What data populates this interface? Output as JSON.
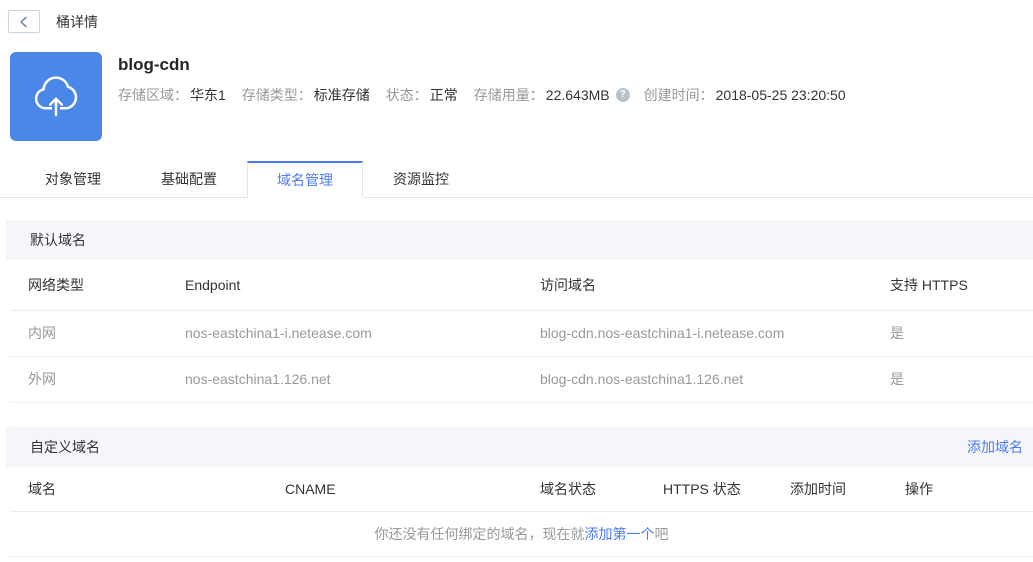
{
  "page": {
    "title": "桶详情"
  },
  "icons": {
    "help_glyph": "?"
  },
  "colors": {
    "accent_blue": "#4d7bf3",
    "bucket_icon_bg": "#4a87e8",
    "section_header_bg": "#f4f6f9",
    "muted_text": "#999999",
    "dark_text": "#333333"
  },
  "bucket": {
    "name": "blog-cdn",
    "meta": [
      {
        "label": "存储区域：",
        "value": "华东1"
      },
      {
        "label": "存储类型：",
        "value": "标准存储"
      },
      {
        "label": "状态：",
        "value": "正常"
      },
      {
        "label": "存储用量：",
        "value": "22.643MB"
      },
      {
        "label": "创建时间：",
        "value": "2018-05-25 23:20:50"
      }
    ]
  },
  "tabs": [
    {
      "label": "对象管理",
      "active": false
    },
    {
      "label": "基础配置",
      "active": false
    },
    {
      "label": "域名管理",
      "active": true
    },
    {
      "label": "资源监控",
      "active": false
    }
  ],
  "default_domains": {
    "section_title": "默认域名",
    "columns": [
      "网络类型",
      "Endpoint",
      "访问域名",
      "支持 HTTPS"
    ],
    "rows": [
      {
        "network": "内网",
        "endpoint": "nos-eastchina1-i.netease.com",
        "domain": "blog-cdn.nos-eastchina1-i.netease.com",
        "https": "是"
      },
      {
        "network": "外网",
        "endpoint": "nos-eastchina1.126.net",
        "domain": "blog-cdn.nos-eastchina1.126.net",
        "https": "是"
      }
    ]
  },
  "custom_domains": {
    "section_title": "自定义域名",
    "add_link": "添加域名",
    "columns": [
      "域名",
      "CNAME",
      "域名状态",
      "HTTPS 状态",
      "添加时间",
      "操作"
    ],
    "empty": {
      "prefix": "你还没有任何绑定的域名，现在就",
      "link": "添加第一个",
      "suffix": "吧"
    }
  }
}
